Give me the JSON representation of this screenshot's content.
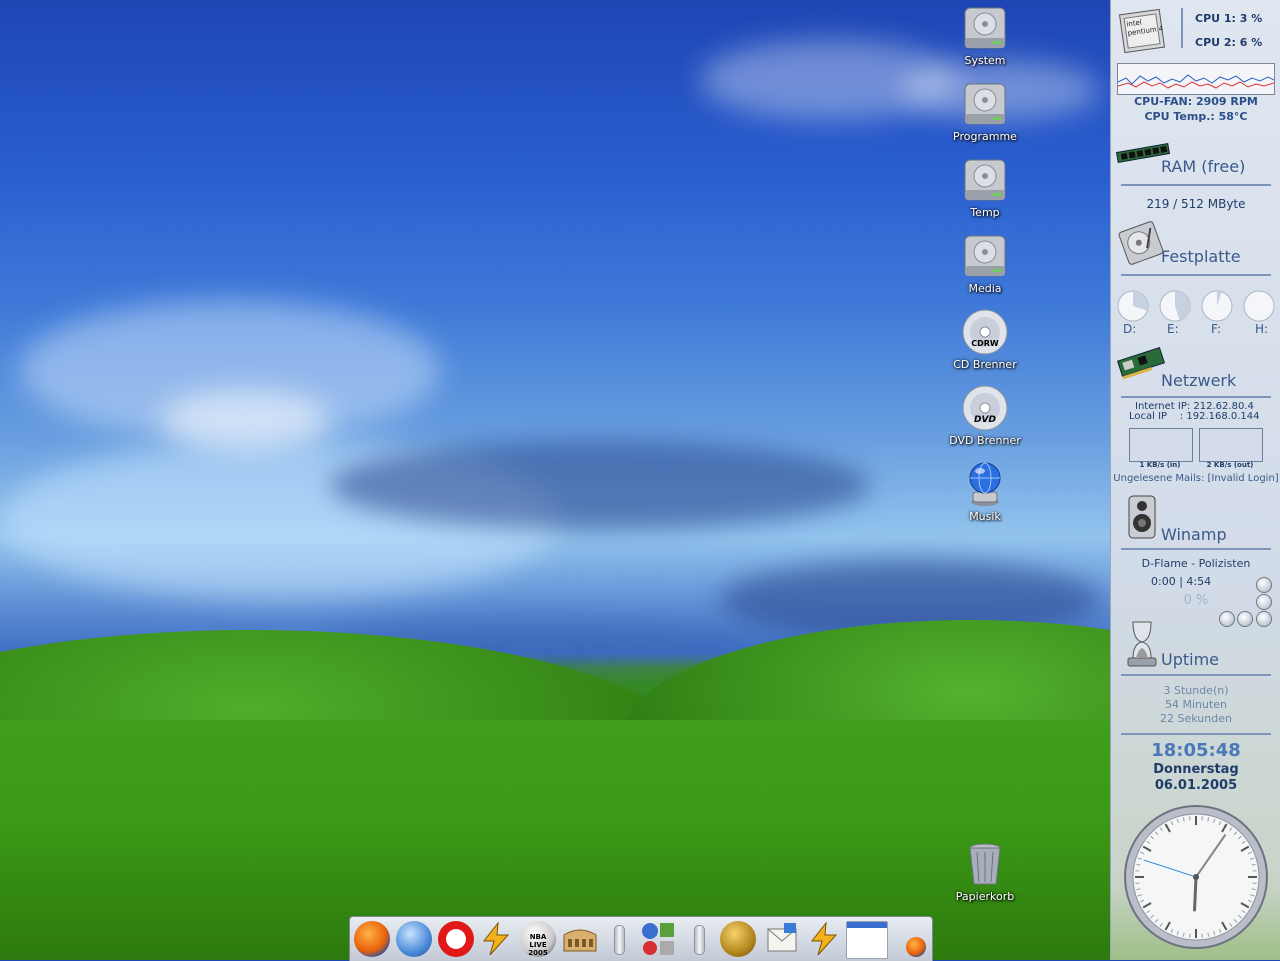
{
  "desktop": {
    "icons": [
      {
        "label": "System",
        "icon": "hard-drive-icon"
      },
      {
        "label": "Programme",
        "icon": "hard-drive-icon"
      },
      {
        "label": "Temp",
        "icon": "hard-drive-icon"
      },
      {
        "label": "Media",
        "icon": "hard-drive-icon"
      },
      {
        "label": "CD Brenner",
        "icon": "cd-burner-icon",
        "badge": "CDRW"
      },
      {
        "label": "DVD Brenner",
        "icon": "dvd-burner-icon",
        "badge": "DVD"
      },
      {
        "label": "Musik",
        "icon": "music-globe-icon"
      },
      {
        "label": "Papierkorb",
        "icon": "recycle-bin-icon"
      }
    ]
  },
  "sidebar": {
    "cpu": {
      "chip_label": "intel pentium 4",
      "cpu1": "CPU 1: 3 %",
      "cpu2": "CPU 2: 6 %",
      "fan": "CPU-FAN: 2909 RPM",
      "temp": "CPU Temp.: 58°C"
    },
    "ram": {
      "title": "RAM (free)",
      "value": "219 / 512 MByte"
    },
    "disk": {
      "title": "Festplatte",
      "drives": [
        {
          "label": "D:",
          "fill": 0.3
        },
        {
          "label": "E:",
          "fill": 0.45
        },
        {
          "label": "F:",
          "fill": 0.05
        },
        {
          "label": "H:",
          "fill": 0.0
        }
      ]
    },
    "network": {
      "title": "Netzwerk",
      "internet_ip": "Internet IP: 212.62.80.4",
      "local_ip": "Local IP    : 192.168.0.144",
      "in_label": "1 KB/s (in)",
      "out_label": "2 KB/s (out)",
      "mails": "Ungelesene Mails: [Invalid Login]"
    },
    "winamp": {
      "title": "Winamp",
      "track": "D-Flame - Polizisten",
      "time": "0:00 | 4:54",
      "volume": "0 %"
    },
    "uptime": {
      "title": "Uptime",
      "hours": "3 Stunde(n)",
      "minutes": "54 Minuten",
      "seconds": "22 Sekunden"
    },
    "clock": {
      "time": "18:05:48",
      "day": "Donnerstag",
      "date": "06.01.2005",
      "hour": 18,
      "minute": 5,
      "second": 48
    }
  },
  "taskbar": {
    "icons": [
      "firefox-icon",
      "thunderbird-icon",
      "opera-icon",
      "winamp-icon",
      "nba-live-icon",
      "colosseum-icon",
      "separator",
      "app-icon",
      "separator",
      "film-icon",
      "mail-icon",
      "winamp-icon",
      "window-icon",
      "firefox-small-icon"
    ],
    "nba_label": "NBA LIVE 2005"
  },
  "colors": {
    "sidebar_text": "#1f3d6a",
    "sidebar_heading": "#3a5a8a",
    "clock_digital": "#4a78b8"
  }
}
